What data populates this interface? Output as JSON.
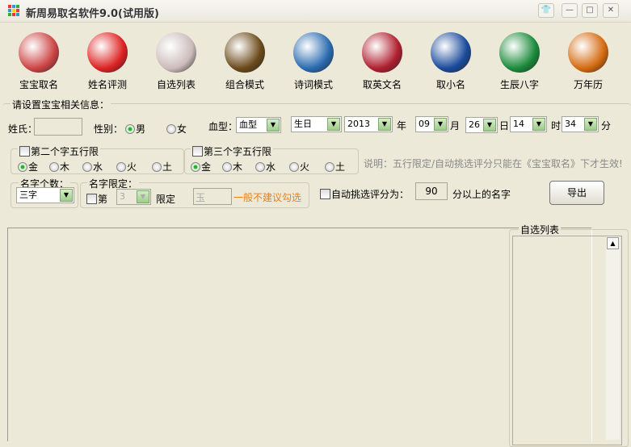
{
  "window": {
    "title": "新周易取名软件9.0(试用版)"
  },
  "toolbar": [
    {
      "label": "宝宝取名",
      "icon": "children-icon",
      "color": "#c44"
    },
    {
      "label": "姓名评测",
      "icon": "fu-icon",
      "color": "#d22"
    },
    {
      "label": "自选列表",
      "icon": "brushes-icon",
      "color": "#cbb"
    },
    {
      "label": "组合模式",
      "icon": "lion-icon",
      "color": "#6b4a1a"
    },
    {
      "label": "诗词模式",
      "icon": "book-cd-icon",
      "color": "#2a6bb0"
    },
    {
      "label": "取英文名",
      "icon": "crest-icon",
      "color": "#b02030"
    },
    {
      "label": "取小名",
      "icon": "wolf-icon",
      "color": "#1a4a9a"
    },
    {
      "label": "生辰八字",
      "icon": "bagua-icon",
      "color": "#1a8a3a"
    },
    {
      "label": "万年历",
      "icon": "calendar-icon",
      "color": "#d46a10"
    }
  ],
  "form": {
    "section_title": "请设置宝宝相关信息：",
    "surname_label": "姓氏：",
    "surname_value": "",
    "gender_label": "性别：",
    "male": "男",
    "female": "女",
    "blood_label": "血型：",
    "blood_value": "血型",
    "birth_value": "生日",
    "year": "2013",
    "year_unit": "年",
    "month": "09",
    "month_unit": "月",
    "day": "26",
    "day_unit": "日",
    "hour": "14",
    "hour_unit": "时",
    "minute": "34",
    "minute_unit": "分",
    "second_char_label": "第二个字五行限",
    "third_char_label": "第三个字五行限",
    "elements": [
      "金",
      "木",
      "水",
      "火",
      "土"
    ],
    "note": "说明：五行限定/自动挑选评分只能在《宝宝取名》下才生效!",
    "count_label": "名字个数：",
    "count_value": "三字",
    "limit_label": "名字限定：",
    "limit_prefix": "第",
    "limit_pos": "3",
    "limit_word": "限定",
    "limit_char": "玉",
    "limit_hint": "一般不建议勾选",
    "auto_label": "自动挑选评分为：",
    "auto_score": "90",
    "auto_suffix": "分以上的名字",
    "export": "导出"
  },
  "favorites": {
    "title": "自选列表"
  }
}
